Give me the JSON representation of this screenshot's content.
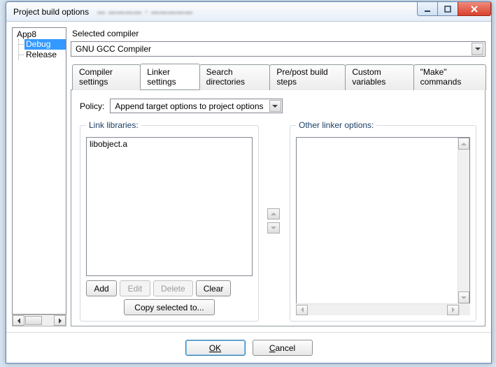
{
  "window": {
    "title": "Project build options"
  },
  "tree": {
    "root": "App8",
    "items": [
      "Debug",
      "Release"
    ],
    "selected_index": 0
  },
  "compiler": {
    "label": "Selected compiler",
    "value": "GNU GCC Compiler"
  },
  "tabs": {
    "items": [
      "Compiler settings",
      "Linker settings",
      "Search directories",
      "Pre/post build steps",
      "Custom variables",
      "\"Make\" commands"
    ],
    "active_index": 1
  },
  "policy": {
    "label": "Policy:",
    "value": "Append target options to project options"
  },
  "link_libraries": {
    "legend": "Link libraries:",
    "items": [
      "libobject.a"
    ],
    "buttons": {
      "add": "Add",
      "edit": "Edit",
      "delete": "Delete",
      "clear": "Clear"
    },
    "copy": "Copy selected to..."
  },
  "other_linker": {
    "legend": "Other linker options:",
    "value": ""
  },
  "footer": {
    "ok": "OK",
    "cancel": "Cancel"
  }
}
